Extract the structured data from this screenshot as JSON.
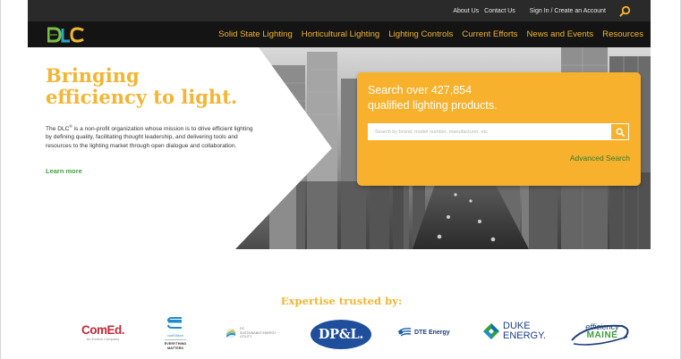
{
  "utility_nav": {
    "about": "About Us",
    "contact": "Contact Us",
    "account": "Sign In / Create an Account"
  },
  "brand": {
    "logo_text": "DLC"
  },
  "main_nav": [
    {
      "label": "Solid State Lighting"
    },
    {
      "label": "Horticultural Lighting"
    },
    {
      "label": "Lighting Controls"
    },
    {
      "label": "Current Efforts"
    },
    {
      "label": "News and Events"
    },
    {
      "label": "Resources"
    }
  ],
  "hero": {
    "title_line1": "Bringing",
    "title_line2": "efficiency to light.",
    "desc_prefix": "The DLC",
    "desc_reg": "®",
    "desc_rest": " is a non-profit organization whose mission is to drive efficient lighting by defining quality, facilitating thought leadership, and delivering tools and resources to the lighting market through open dialogue and collaboration.",
    "learn_more": "Learn more"
  },
  "search": {
    "title_line1": "Search over 427,854",
    "title_line2": "qualified lighting products.",
    "placeholder": "Search by brand, model number, manufacturer, etc.",
    "advanced": "Advanced Search"
  },
  "partners": {
    "heading": "Expertise trusted by:",
    "logos": [
      {
        "name": "ComEd.",
        "tagline": "An Exelon Company"
      },
      {
        "name": "conEdison",
        "tagline_line1": "EVERYTHING",
        "tagline_line2": "MATTERS"
      },
      {
        "name_line1": "DC",
        "name_line2": "SUSTAINABLE ENERGY",
        "name_line3": "UTILITY"
      },
      {
        "name": "DP&L."
      },
      {
        "name": "DTE Energy"
      },
      {
        "name_line1": "DUKE",
        "name_line2": "ENERGY."
      },
      {
        "name_line1": "efficiency",
        "name_line2": "MAINE"
      }
    ]
  },
  "colors": {
    "brand_gold": "#f3b533",
    "search_card": "#f7b12d",
    "nav_background": "#141414",
    "utility_background": "#2a2a2a",
    "link_green": "#47a047"
  }
}
